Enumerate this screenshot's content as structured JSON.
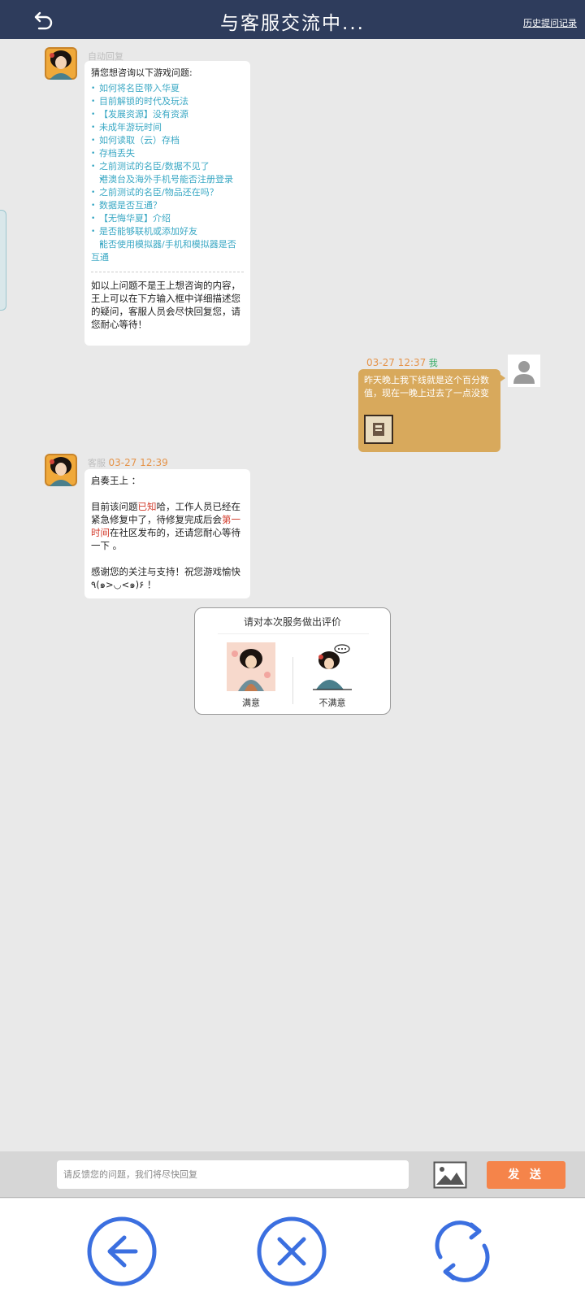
{
  "header": {
    "title": "与客服交流中...",
    "history_link": "历史提问记录",
    "back_icon": "undo-arrow-icon"
  },
  "messages": {
    "auto_reply": {
      "sender": "自动回复",
      "intro": "猜您想咨询以下游戏问题:",
      "questions": [
        "如何将名臣带入华夏",
        "目前解锁的时代及玩法",
        "【发展资源】没有资源",
        "未成年游玩时间",
        "如何读取（云）存档",
        "存档丢失",
        "之前测试的名臣/数据不见了",
        "港澳台及海外手机号能否注册登录",
        "之前测试的名臣/物品还在吗？",
        "数据是否互通？",
        "【无悔华夏】介绍",
        "是否能够联机或添加好友",
        "能否使用模拟器/手机和模拟器是否互通"
      ],
      "outro": "如以上问题不是王上想咨询的内容，王上可以在下方输入框中详细描述您的疑问，客服人员会尽快回复您，请您耐心等待！"
    },
    "user_message": {
      "time": "03-27 12:37",
      "me_label": "我",
      "text": "昨天晚上我下线就是这个百分数值，现在一晚上过去了一点没变"
    },
    "agent_reply": {
      "sender": "客服",
      "time": "03-27 12:39",
      "greeting": "启奏王上 ：",
      "p1_a": "目前该问题",
      "p1_red1": "已知",
      "p1_b": "哈，工作人员已经在紧急修复中了，待修复完成后会",
      "p1_red2": "第一时间",
      "p1_c": "在社区发布的，还请您耐心等待一下 。",
      "p2": "感谢您的关注与支持！祝您游戏愉快٩(๑>◡<๑)۶ ！"
    }
  },
  "rating": {
    "title": "请对本次服务做出评价",
    "satisfied": "满意",
    "unsatisfied": "不满意"
  },
  "input": {
    "placeholder": "请反馈您的问题，我们将尽快回复",
    "send_label": "发 送"
  },
  "colors": {
    "header_bg": "#2e3c5c",
    "link_blue": "#3aa8c4",
    "user_bubble": "#d8a95c",
    "timestamp": "#e5944a",
    "me_green": "#3aae6a",
    "highlight_red": "#d23a2a",
    "send_orange": "#f5844a",
    "nav_blue": "#3b6fe0"
  }
}
